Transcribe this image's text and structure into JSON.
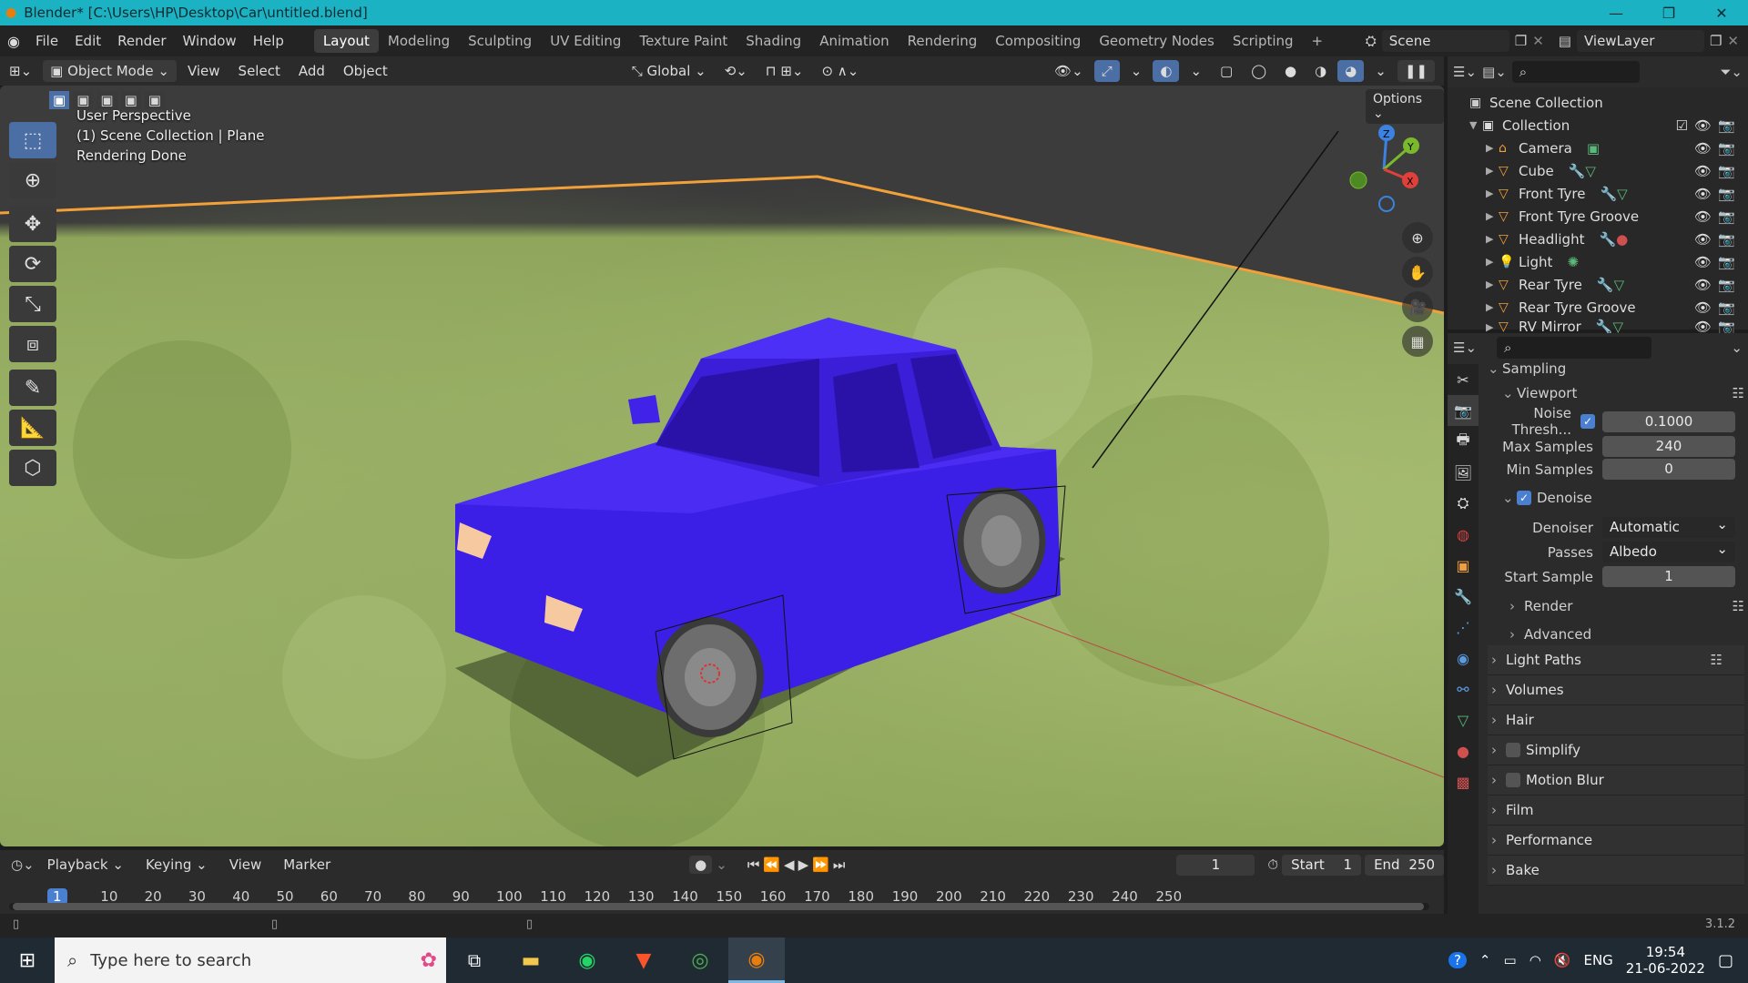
{
  "window": {
    "title": "Blender* [C:\\Users\\HP\\Desktop\\Car\\untitled.blend]"
  },
  "menu": [
    "File",
    "Edit",
    "Render",
    "Window",
    "Help"
  ],
  "workspaces": [
    "Layout",
    "Modeling",
    "Sculpting",
    "UV Editing",
    "Texture Paint",
    "Shading",
    "Animation",
    "Rendering",
    "Compositing",
    "Geometry Nodes",
    "Scripting"
  ],
  "active_workspace": "Layout",
  "scene": "Scene",
  "view_layer": "ViewLayer",
  "header": {
    "mode": "Object Mode",
    "menus": [
      "View",
      "Select",
      "Add",
      "Object"
    ],
    "transform": "Global",
    "options": "Options"
  },
  "viewport": {
    "line1": "User Perspective",
    "line2": "(1) Scene Collection | Plane",
    "line3": "Rendering Done",
    "car_color": "#3a1fe0",
    "ground_color": "#9bb36a"
  },
  "outliner": {
    "root": "Scene Collection",
    "collection": "Collection",
    "items": [
      "Camera",
      "Cube",
      "Front Tyre",
      "Front Tyre Groove",
      "Headlight",
      "Light",
      "Rear Tyre",
      "Rear Tyre Groove",
      "RV Mirror"
    ]
  },
  "properties": {
    "sampling": "Sampling",
    "viewport": "Viewport",
    "noise_label": "Noise Thresh...",
    "noise_value": "0.1000",
    "max_samples_label": "Max Samples",
    "max_samples": "240",
    "min_samples_label": "Min Samples",
    "min_samples": "0",
    "denoise": "Denoise",
    "denoiser_label": "Denoiser",
    "denoiser": "Automatic",
    "passes_label": "Passes",
    "passes": "Albedo",
    "start_sample_label": "Start Sample",
    "start_sample": "1",
    "render": "Render",
    "advanced": "Advanced",
    "sections": [
      "Light Paths",
      "Volumes",
      "Hair",
      "Simplify",
      "Motion Blur",
      "Film",
      "Performance",
      "Bake"
    ]
  },
  "timeline": {
    "menus": [
      "Playback",
      "Keying",
      "View",
      "Marker"
    ],
    "current_frame": "1",
    "start_label": "Start",
    "start": "1",
    "end_label": "End",
    "end": "250",
    "ticks": [
      "1",
      "10",
      "20",
      "30",
      "40",
      "50",
      "60",
      "70",
      "80",
      "90",
      "100",
      "110",
      "120",
      "130",
      "140",
      "150",
      "160",
      "170",
      "180",
      "190",
      "200",
      "210",
      "220",
      "230",
      "240",
      "250"
    ]
  },
  "status": {
    "version": "3.1.2"
  },
  "taskbar": {
    "search_placeholder": "Type here to search",
    "lang": "ENG",
    "time": "19:54",
    "date": "21-06-2022"
  }
}
